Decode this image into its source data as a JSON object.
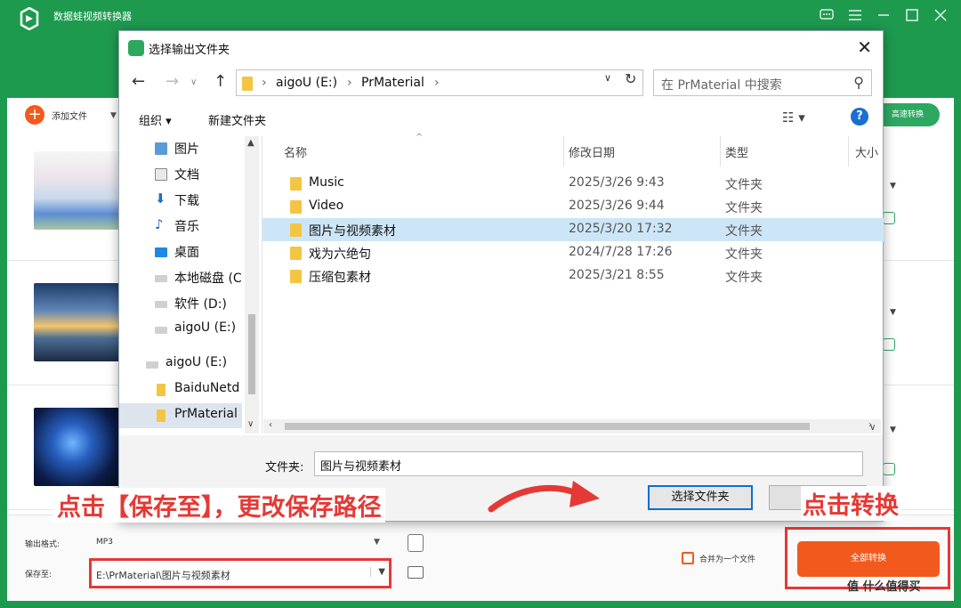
{
  "app": {
    "title": "数据蛙视频转换器",
    "add_file_label": "添加文件",
    "fast_convert_label": "高速转换",
    "output_format_label": "输出格式:",
    "output_format_value": "MP3",
    "save_to_label": "保存至:",
    "save_to_path": "E:\\PrMaterial\\图片与视频素材",
    "merge_label": "合并为一个文件",
    "convert_all_label": "全部转换",
    "accent_color": "#1e9a4f",
    "button_color": "#f25a1d"
  },
  "dialog": {
    "title": "选择输出文件夹",
    "address": {
      "parts": [
        "aigoU (E:)",
        "PrMaterial"
      ]
    },
    "search_placeholder": "在 PrMaterial 中搜索",
    "toolbar": {
      "organize": "组织 ▾",
      "new_folder": "新建文件夹"
    },
    "tree": [
      {
        "label": "图片",
        "icon": "pictures-icon"
      },
      {
        "label": "文档",
        "icon": "documents-icon"
      },
      {
        "label": "下载",
        "icon": "download-icon"
      },
      {
        "label": "音乐",
        "icon": "music-icon"
      },
      {
        "label": "桌面",
        "icon": "desktop-icon"
      },
      {
        "label": "本地磁盘 (C",
        "icon": "drive-icon"
      },
      {
        "label": "软件 (D:)",
        "icon": "drive-icon"
      },
      {
        "label": "aigoU (E:)",
        "icon": "drive-icon"
      },
      {
        "label": "aigoU (E:)",
        "icon": "drive-icon"
      },
      {
        "label": "BaiduNetd",
        "icon": "folder-icon"
      },
      {
        "label": "PrMaterial",
        "icon": "folder-icon"
      }
    ],
    "columns": {
      "name": "名称",
      "modified": "修改日期",
      "type": "类型",
      "size": "大小"
    },
    "files": [
      {
        "name": "Music",
        "modified": "2025/3/26 9:43",
        "type": "文件夹"
      },
      {
        "name": "Video",
        "modified": "2025/3/26 9:44",
        "type": "文件夹"
      },
      {
        "name": "图片与视频素材",
        "modified": "2025/3/20 17:32",
        "type": "文件夹"
      },
      {
        "name": "戏为六绝句",
        "modified": "2024/7/28 17:26",
        "type": "文件夹"
      },
      {
        "name": "压缩包素材",
        "modified": "2025/3/21 8:55",
        "type": "文件夹"
      }
    ],
    "folder_label": "文件夹:",
    "folder_value": "图片与视频素材",
    "select_folder_button": "选择文件夹"
  },
  "annotations": {
    "left": "点击【保存至】，更改保存路径",
    "right": "点击转换",
    "highlight_color": "#e53935"
  },
  "watermark": "值 什么值得买"
}
